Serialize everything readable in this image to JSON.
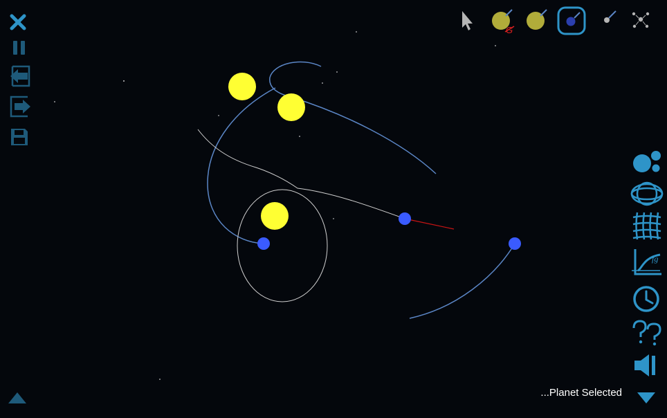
{
  "status": {
    "message": "...Planet Selected"
  },
  "colors": {
    "background": "#04070c",
    "accent": "#2e94c8",
    "star": "#ffff33",
    "planet": "#3a5bff",
    "orbit_trail": "#5b86c6",
    "path_trail": "#c8c8c8",
    "velocity_vector": "#c81414",
    "star_tool_fill": "#b1ac3a"
  },
  "left_toolbar": [
    {
      "name": "close",
      "icon": "close-icon"
    },
    {
      "name": "pause",
      "icon": "pause-icon"
    },
    {
      "name": "load",
      "icon": "import-icon"
    },
    {
      "name": "export",
      "icon": "export-icon"
    },
    {
      "name": "save",
      "icon": "save-icon"
    }
  ],
  "top_toolbar": [
    {
      "name": "select",
      "icon": "cursor-icon"
    },
    {
      "name": "add-star-no-gravity",
      "icon": "star-no-gravity-icon"
    },
    {
      "name": "add-star",
      "icon": "star-icon"
    },
    {
      "name": "add-planet",
      "icon": "planet-icon",
      "selected": true
    },
    {
      "name": "add-asteroid",
      "icon": "asteroid-icon"
    },
    {
      "name": "scatter",
      "icon": "scatter-icon"
    }
  ],
  "right_toolbar": [
    {
      "name": "bodies",
      "icon": "bodies-icon"
    },
    {
      "name": "orbits",
      "icon": "orbit-icon"
    },
    {
      "name": "grid",
      "icon": "grid-icon"
    },
    {
      "name": "graph",
      "icon": "graph-icon"
    },
    {
      "name": "time",
      "icon": "clock-icon"
    },
    {
      "name": "help",
      "icon": "help-icon"
    },
    {
      "name": "sound",
      "icon": "speaker-icon"
    },
    {
      "name": "collapse",
      "icon": "triangle-down-icon"
    }
  ],
  "bottom_left": {
    "icon": "triangle-up-icon"
  }
}
